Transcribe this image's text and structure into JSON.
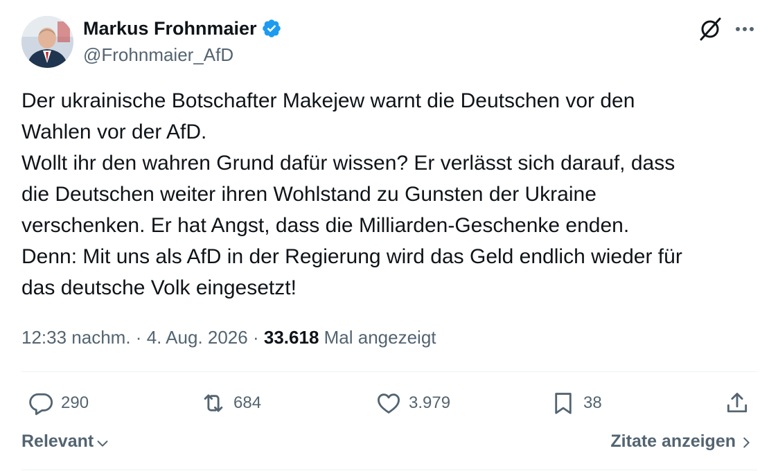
{
  "author": {
    "display_name": "Markus Frohnmaier",
    "handle": "@Frohnmaier_AfD",
    "verified": true
  },
  "tweet": {
    "text": "Der ukrainische Botschafter Makejew warnt die Deutschen vor den\nWahlen vor der AfD.\nWollt ihr den wahren Grund dafür wissen? Er verlässt sich darauf, dass\ndie Deutschen weiter ihren Wohlstand zu Gunsten der Ukraine\nverschenken. Er hat Angst, dass die Milliarden-Geschenke enden.\nDenn: Mit uns als AfD in der Regierung wird das Geld endlich wieder für\ndas deutsche Volk eingesetzt!",
    "time": "12:33 nachm.",
    "date": "4. Aug. 2026",
    "separator": "·",
    "views_count": "33.618",
    "views_label": "Mal angezeigt"
  },
  "actions": {
    "replies": "290",
    "reposts": "684",
    "likes": "3.979",
    "bookmarks": "38"
  },
  "footer": {
    "sort_label": "Relevant",
    "quotes_label": "Zitate anzeigen"
  },
  "icons": {
    "verified": "verified-badge-icon",
    "grok": "grok-icon",
    "more": "more-horizontal-icon",
    "reply": "reply-icon",
    "repost": "repost-icon",
    "like": "heart-icon",
    "bookmark": "bookmark-icon",
    "share": "share-icon"
  },
  "colors": {
    "text_primary": "#0f1419",
    "text_secondary": "#536471",
    "verified_blue": "#1d9bf0",
    "divider": "#eff3f4"
  }
}
